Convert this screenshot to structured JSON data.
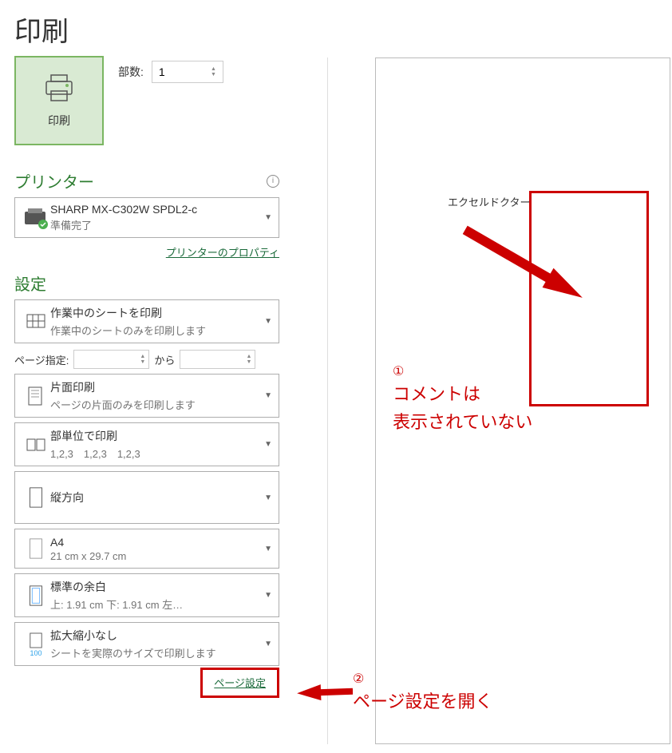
{
  "page_title": "印刷",
  "print_button_label": "印刷",
  "copies": {
    "label": "部数:",
    "value": "1"
  },
  "section_printer": "プリンター",
  "printer": {
    "name": "SHARP MX-C302W SPDL2-c",
    "status": "準備完了"
  },
  "printer_properties_link": "プリンターのプロパティ",
  "section_settings": "設定",
  "scope": {
    "title": "作業中のシートを印刷",
    "sub": "作業中のシートのみを印刷します"
  },
  "page_range": {
    "label": "ページ指定:",
    "separator": "から"
  },
  "sides": {
    "title": "片面印刷",
    "sub": "ページの片面のみを印刷します"
  },
  "collate": {
    "title": "部単位で印刷",
    "sub": "1,2,3　1,2,3　1,2,3"
  },
  "orientation": {
    "title": "縦方向"
  },
  "paper": {
    "title": "A4",
    "sub": "21 cm x 29.7 cm"
  },
  "margins": {
    "title": "標準の余白",
    "sub": "上: 1.91 cm 下: 1.91 cm 左…"
  },
  "scaling": {
    "title": "拡大縮小なし",
    "sub": "シートを実際のサイズで印刷します",
    "badge": "100"
  },
  "page_setup_link": "ページ設定",
  "preview": {
    "header_text": "エクセルドクター"
  },
  "annotation_1": {
    "num": "①",
    "line1": "コメントは",
    "line2": "表示されていない"
  },
  "annotation_2": {
    "num": "②",
    "text": "ページ設定を開く"
  }
}
